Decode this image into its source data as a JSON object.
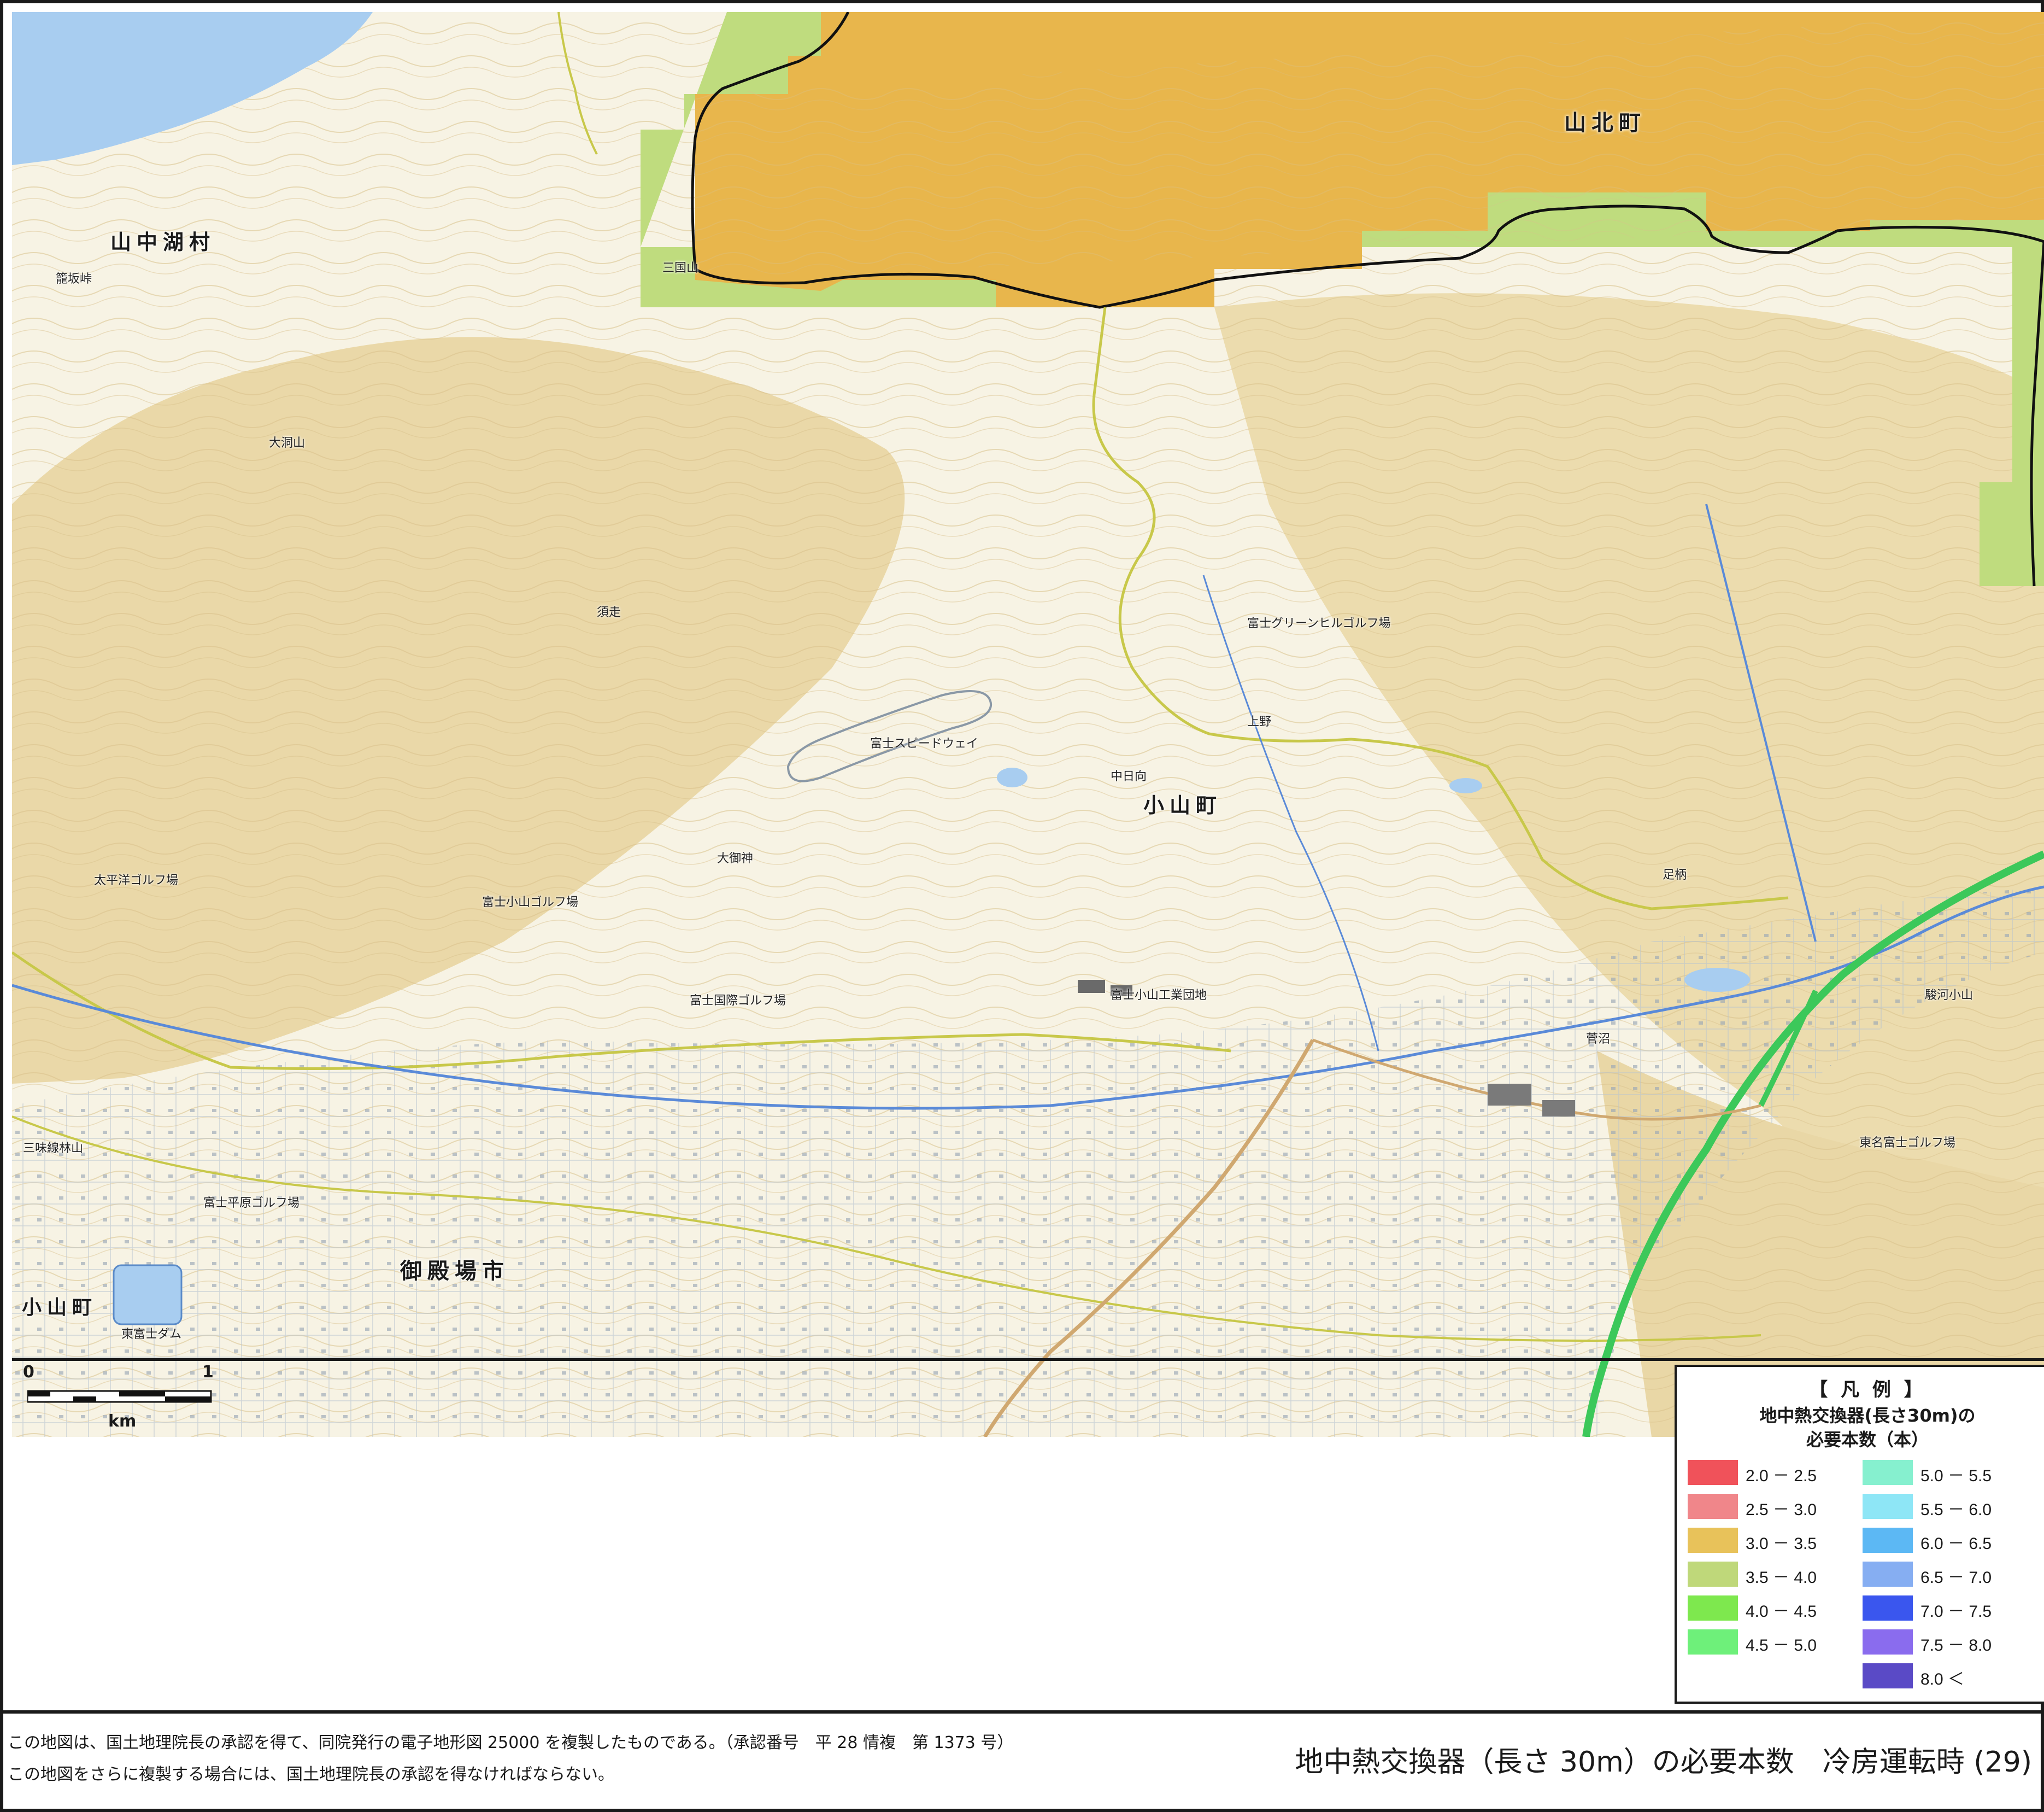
{
  "map": {
    "place_labels": [
      {
        "id": "yamanakako",
        "text": "山中湖村"
      },
      {
        "id": "yamakita",
        "text": "山北町"
      },
      {
        "id": "oyama-center",
        "text": "小山町"
      },
      {
        "id": "gotemba",
        "text": "御殿場市"
      },
      {
        "id": "oyama-southwest",
        "text": "小山町"
      }
    ],
    "small_labels": [
      "富士スピードウェイ",
      "富士グリーンヒルゴルフ場",
      "大洞山",
      "三国山",
      "富士小山ゴルフ場",
      "富士国際ゴルフ場",
      "太平洋ゴルフ場",
      "富士小山工業団地",
      "三味線林山",
      "富士平原ゴルフ場",
      "東富士ダム",
      "須走",
      "中日向",
      "大御神",
      "足柄",
      "菅沼",
      "上野",
      "籠坂峠",
      "東名富士ゴルフ場",
      "駿河小山"
    ],
    "fill_colors": {
      "base": "#f7f3e4",
      "terrain_tan": "#e8d6a6",
      "orange_zone": "#e8b64c",
      "green_zone": "#b9d97a",
      "water": "#a8cdf0"
    }
  },
  "scale_bar": {
    "zero": "0",
    "one": "1",
    "unit": "km"
  },
  "legend": {
    "title": "【 凡 例 】",
    "subtitle_line1": "地中熱交換器(長さ30m)の",
    "subtitle_line2": "必要本数（本）",
    "items": [
      {
        "label": "2.0 － 2.5",
        "color": "#f0525a"
      },
      {
        "label": "2.5 － 3.0",
        "color": "#f0868a"
      },
      {
        "label": "3.0 － 3.5",
        "color": "#e8c25a"
      },
      {
        "label": "3.5 － 4.0",
        "color": "#bfd87a"
      },
      {
        "label": "4.0 － 4.5",
        "color": "#7ee84e"
      },
      {
        "label": "4.5 － 5.0",
        "color": "#6ef07a"
      },
      {
        "label": "5.0 － 5.5",
        "color": "#86f0cf"
      },
      {
        "label": "5.5 － 6.0",
        "color": "#8ee6f6"
      },
      {
        "label": "6.0 － 6.5",
        "color": "#5cb8f4"
      },
      {
        "label": "6.5 － 7.0",
        "color": "#86aef2"
      },
      {
        "label": "7.0 － 7.5",
        "color": "#3a56ee"
      },
      {
        "label": "7.5 － 8.0",
        "color": "#8a6cee"
      },
      {
        "label": "8.0 ＜",
        "color": "#5a4ac6"
      }
    ]
  },
  "footer": {
    "note_line1": "この地図は、国土地理院長の承認を得て、同院発行の電子地形図 25000 を複製したものである。（承認番号　平 28 情複　第 1373 号）",
    "note_line2": "この地図をさらに複製する場合には、国土地理院長の承認を得なければならない。",
    "caption": "地中熱交換器（長さ 30m）の必要本数　冷房運転時 (29)"
  }
}
